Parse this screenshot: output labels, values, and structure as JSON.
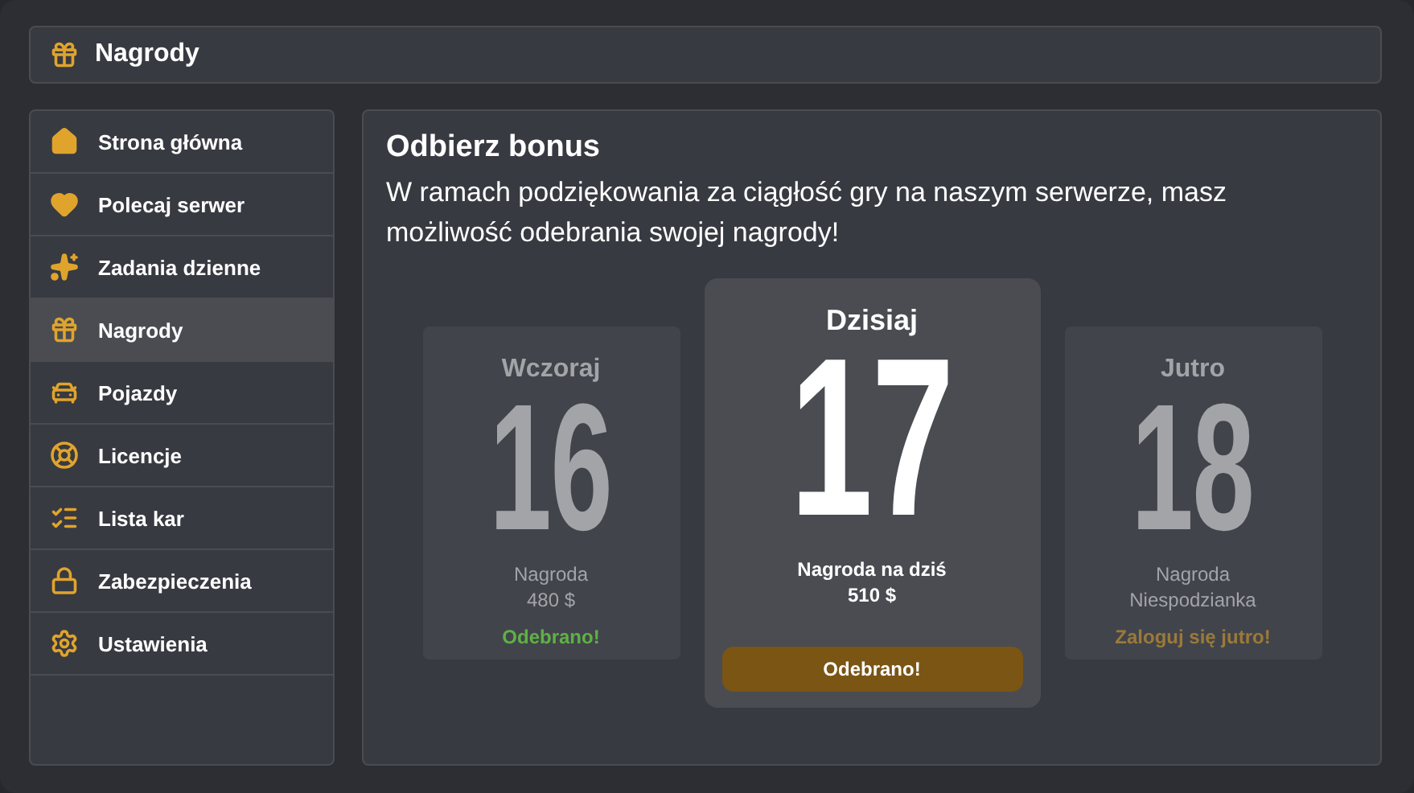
{
  "header": {
    "title": "Nagrody"
  },
  "sidebar": {
    "items": [
      {
        "label": "Strona główna",
        "selected": false
      },
      {
        "label": "Polecaj serwer",
        "selected": false
      },
      {
        "label": "Zadania dzienne",
        "selected": false
      },
      {
        "label": "Nagrody",
        "selected": true
      },
      {
        "label": "Pojazdy",
        "selected": false
      },
      {
        "label": "Licencje",
        "selected": false
      },
      {
        "label": "Lista kar",
        "selected": false
      },
      {
        "label": "Zabezpieczenia",
        "selected": false
      },
      {
        "label": "Ustawienia",
        "selected": false
      }
    ]
  },
  "main": {
    "title": "Odbierz bonus",
    "text": "W ramach podziękowania za ciągłość gry na naszym serwerze, masz możliwość odebrania swojej nagrody!",
    "cards": [
      {
        "kind": "past",
        "day_label": "Wczoraj",
        "number": "16",
        "reward_label": "Nagroda",
        "reward_value": "480 $",
        "status": "Odebrano!"
      },
      {
        "kind": "today",
        "day_label": "Dzisiaj",
        "number": "17",
        "reward_label": "Nagroda na dziś",
        "reward_value": "510 $",
        "status": "Odebrano!"
      },
      {
        "kind": "future",
        "day_label": "Jutro",
        "number": "18",
        "reward_label": "Nagroda",
        "reward_value": "Niespodzianka",
        "status": "Zaloguj się jutro!"
      }
    ]
  }
}
